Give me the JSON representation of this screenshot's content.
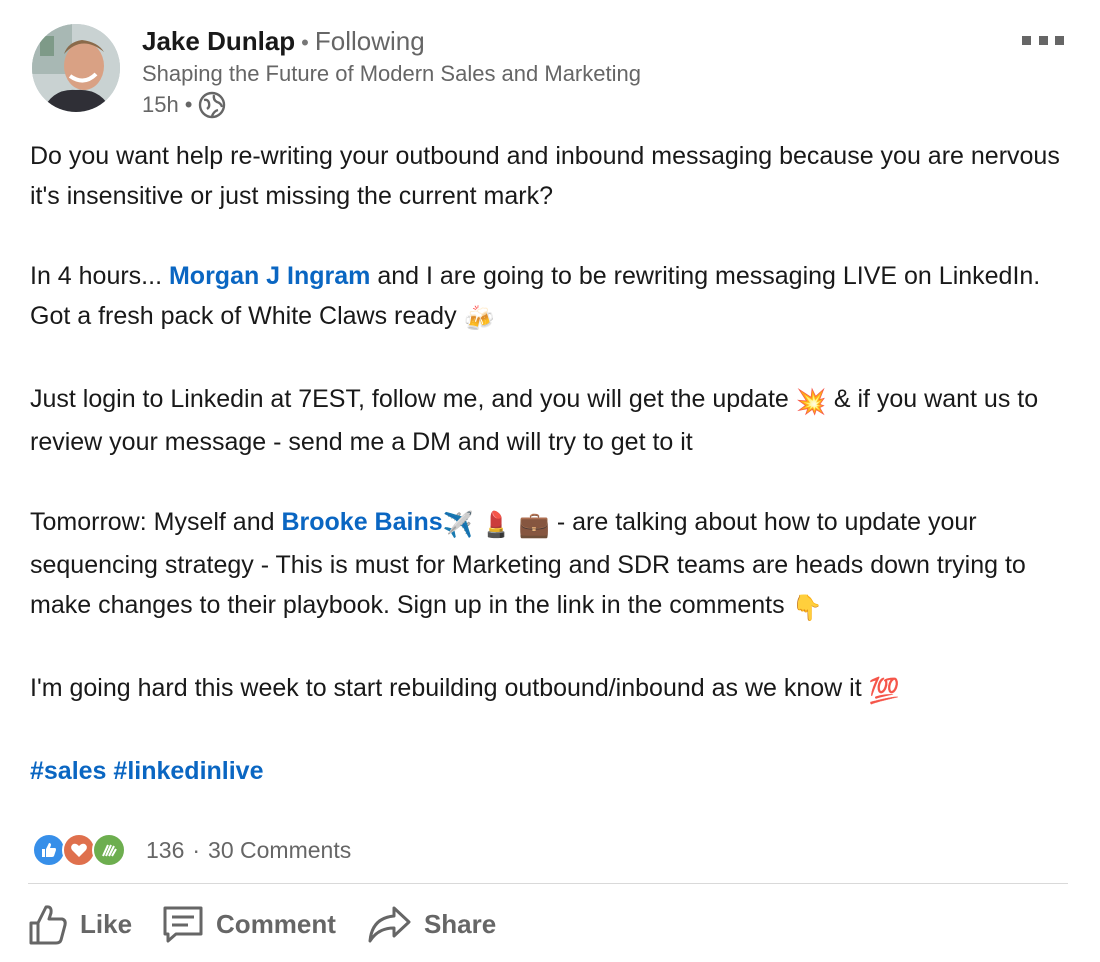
{
  "author": {
    "name": "Jake Dunlap",
    "relation": "Following",
    "headline": "Shaping the Future of Modern Sales and Marketing",
    "time": "15h",
    "visibility_icon": "globe-icon"
  },
  "post": {
    "p1": "Do you want help re-writing your outbound and inbound messaging because you are nervous it's insensitive or just missing the current mark?",
    "p2_a": "In 4 hours... ",
    "p2_mention": "Morgan J Ingram",
    "p2_b": " and I are going to be rewriting messaging LIVE on LinkedIn. Got a fresh pack of White Claws ready ",
    "p2_emoji": "🍻",
    "p3_a": "Just login to Linkedin at 7EST, follow me, and you will get the update ",
    "p3_emoji": "💥",
    "p3_b": " & if you want us to review your message - send me a DM and will try to get to it",
    "p4_a": "Tomorrow: Myself and ",
    "p4_mention": "Brooke Bains",
    "p4_emojis": " ✈️ 💄 💼 ",
    "p4_b": " - are talking about how to update your sequencing strategy - This is must for Marketing and SDR teams are heads down trying to make changes to their playbook. Sign up in the link in the comments ",
    "p4_emoji2": "👇",
    "p5": "I'm going hard this week to start rebuilding outbound/inbound as we know it ",
    "p5_emoji": "💯",
    "hashtags": [
      "#sales",
      "#linkedinlive"
    ]
  },
  "social": {
    "reaction_icons": [
      "like-reaction-icon",
      "love-reaction-icon",
      "support-reaction-icon"
    ],
    "reaction_count": "136",
    "separator": "·",
    "comments": "30 Comments"
  },
  "actions": {
    "like": "Like",
    "comment": "Comment",
    "share": "Share"
  },
  "colors": {
    "link": "#0a66c2",
    "muted": "#666666",
    "like_reaction": "#378fe9",
    "love_reaction": "#df704d",
    "support_reaction": "#6dae4f"
  }
}
